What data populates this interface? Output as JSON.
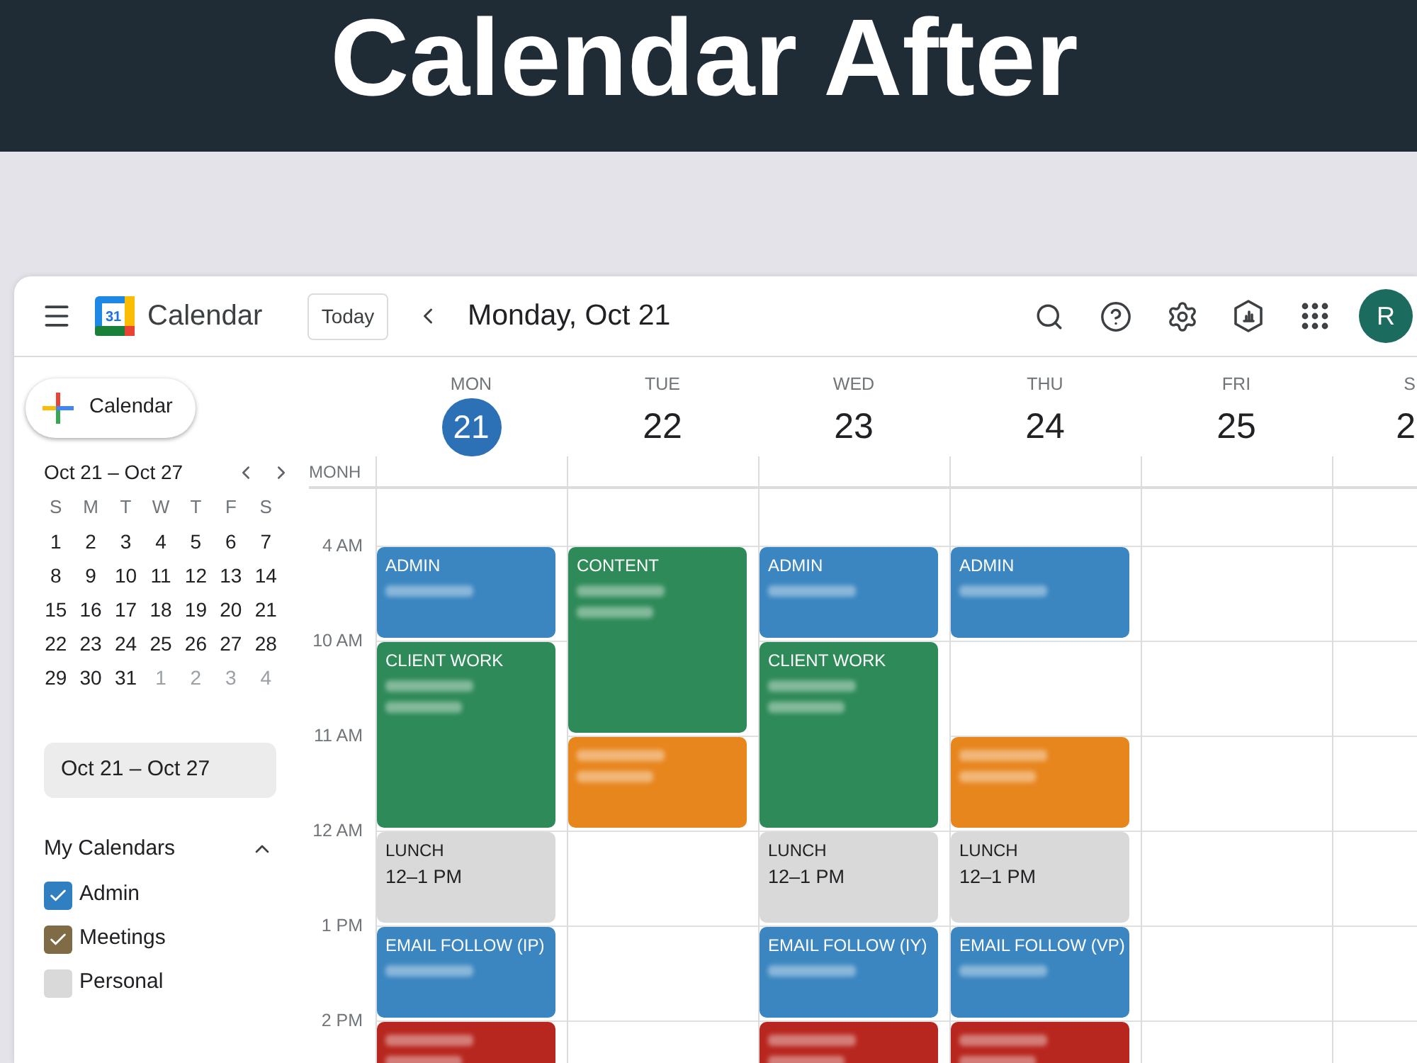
{
  "banner": {
    "title": "Calendar After"
  },
  "header": {
    "logo": "31",
    "app_name": "Calendar",
    "today_button": "Today",
    "title": "Monday, Oct 21",
    "avatar": "R"
  },
  "sidebar": {
    "create_button": "Calendar",
    "mini_calendar": {
      "range": "Oct 21 – Oct 27",
      "weekdays": [
        "S",
        "M",
        "T",
        "W",
        "T",
        "F",
        "S"
      ],
      "weeks": [
        [
          {
            "label": "1",
            "dimmed": false
          },
          {
            "label": "2",
            "dimmed": false
          },
          {
            "label": "3",
            "dimmed": false
          },
          {
            "label": "4",
            "dimmed": false
          },
          {
            "label": "5",
            "dimmed": false
          },
          {
            "label": "6",
            "dimmed": false
          },
          {
            "label": "7",
            "dimmed": false
          }
        ],
        [
          {
            "label": "8",
            "dimmed": false
          },
          {
            "label": "9",
            "dimmed": false
          },
          {
            "label": "10",
            "dimmed": false
          },
          {
            "label": "11",
            "dimmed": false
          },
          {
            "label": "12",
            "dimmed": false
          },
          {
            "label": "13",
            "dimmed": false
          },
          {
            "label": "14",
            "dimmed": false
          }
        ],
        [
          {
            "label": "15",
            "dimmed": false
          },
          {
            "label": "16",
            "dimmed": false
          },
          {
            "label": "17",
            "dimmed": false
          },
          {
            "label": "18",
            "dimmed": false
          },
          {
            "label": "19",
            "dimmed": false
          },
          {
            "label": "20",
            "dimmed": false
          },
          {
            "label": "21",
            "dimmed": false
          }
        ],
        [
          {
            "label": "22",
            "dimmed": false
          },
          {
            "label": "23",
            "dimmed": false
          },
          {
            "label": "24",
            "dimmed": false
          },
          {
            "label": "25",
            "dimmed": false
          },
          {
            "label": "26",
            "dimmed": false
          },
          {
            "label": "27",
            "dimmed": false
          },
          {
            "label": "28",
            "dimmed": false
          }
        ],
        [
          {
            "label": "29",
            "dimmed": false
          },
          {
            "label": "30",
            "dimmed": false
          },
          {
            "label": "31",
            "dimmed": false
          },
          {
            "label": "1",
            "dimmed": true
          },
          {
            "label": "2",
            "dimmed": true
          },
          {
            "label": "3",
            "dimmed": true
          },
          {
            "label": "4",
            "dimmed": true
          }
        ]
      ]
    },
    "range_chip": "Oct 21 – Oct 27",
    "my_calendars": {
      "title": "My Calendars",
      "expanded": true,
      "items": [
        {
          "label": "Admin",
          "checked": true,
          "color": "#2f7fc1"
        },
        {
          "label": "Meetings",
          "checked": true,
          "color": "#7f6b45"
        },
        {
          "label": "Personal",
          "checked": false,
          "color": "#d9d9d9"
        }
      ]
    }
  },
  "grid": {
    "all_day_label": "MONH",
    "hours": [
      "4 AM",
      "10 AM",
      "11 AM",
      "12 AM",
      "1 PM",
      "2 PM"
    ],
    "days": [
      {
        "name": "MON",
        "number": "21",
        "selected": true,
        "events": [
          {
            "kind": "event",
            "title": "ADMIN",
            "color": "#3b86c0",
            "long": false,
            "blurred": true
          },
          {
            "kind": "event",
            "title": "CLIENT WORK",
            "color": "#2e8a58",
            "long": true,
            "blurred": true
          },
          {
            "kind": "event",
            "title": "LUNCH",
            "time": "12–1 PM",
            "color": "#d9d9d9",
            "long": false,
            "blurred": false
          },
          {
            "kind": "event",
            "title": "EMAIL FOLLOW (IP)",
            "color": "#3b86c0",
            "long": false,
            "blurred": true
          },
          {
            "kind": "event",
            "color": "#b8271f",
            "long": false,
            "blurred": true
          }
        ]
      },
      {
        "name": "TUE",
        "number": "22",
        "selected": false,
        "events": [
          {
            "kind": "event",
            "title": "CONTENT",
            "color": "#2e8a58",
            "long": true,
            "blurred": true
          },
          {
            "kind": "event",
            "color": "#e8861e",
            "long": false,
            "blurred": true
          }
        ]
      },
      {
        "name": "WED",
        "number": "23",
        "selected": false,
        "events": [
          {
            "kind": "event",
            "title": "ADMIN",
            "color": "#3b86c0",
            "long": false,
            "blurred": true
          },
          {
            "kind": "event",
            "title": "CLIENT WORK",
            "color": "#2e8a58",
            "long": true,
            "blurred": true
          },
          {
            "kind": "event",
            "title": "LUNCH",
            "time": "12–1 PM",
            "color": "#d9d9d9",
            "long": false,
            "blurred": false
          },
          {
            "kind": "event",
            "title": "EMAIL FOLLOW (IY)",
            "color": "#3b86c0",
            "long": false,
            "blurred": true
          },
          {
            "kind": "event",
            "color": "#b8271f",
            "long": false,
            "blurred": true
          }
        ]
      },
      {
        "name": "THU",
        "number": "24",
        "selected": false,
        "events": [
          {
            "kind": "event",
            "title": "ADMIN",
            "color": "#3b86c0",
            "long": false,
            "blurred": true
          },
          {
            "kind": "gap",
            "long": false
          },
          {
            "kind": "event",
            "color": "#e8861e",
            "long": false,
            "blurred": true
          },
          {
            "kind": "event",
            "title": "LUNCH",
            "time": "12–1 PM",
            "color": "#d9d9d9",
            "long": false,
            "blurred": false
          },
          {
            "kind": "event",
            "title": "EMAIL FOLLOW (VP)",
            "color": "#3b86c0",
            "long": false,
            "blurred": true
          },
          {
            "kind": "event",
            "color": "#b8271f",
            "long": false,
            "blurred": true
          }
        ]
      },
      {
        "name": "FRI",
        "number": "25",
        "selected": false
      },
      {
        "name": "S",
        "number": "2",
        "selected": false
      }
    ]
  }
}
